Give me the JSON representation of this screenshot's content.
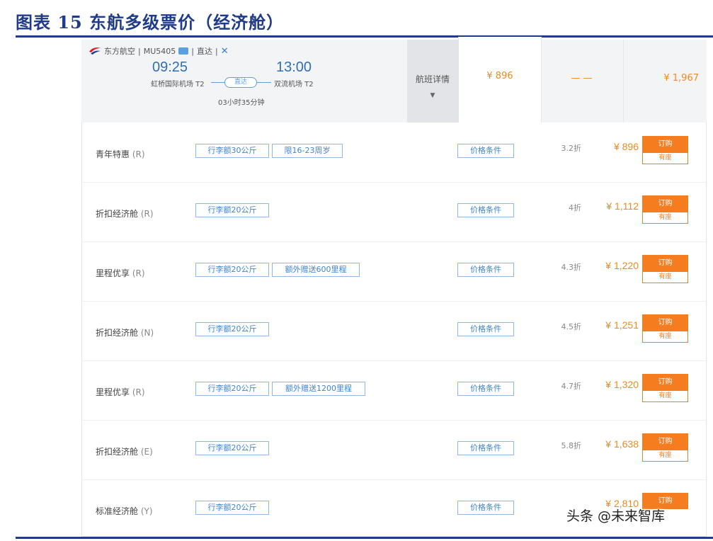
{
  "document": {
    "title": "图表 15    东航多级票价（经济舱）",
    "watermark": "头条 @未来智库"
  },
  "flight": {
    "airline": "东方航空",
    "flight_no": "MU5405",
    "direct_tag": "直达",
    "dep_time": "09:25",
    "arr_time": "13:00",
    "dep_airport": "虹桥国际机场 T2",
    "arr_airport": "双流机场 T2",
    "route_label": "直达",
    "duration": "03小时35分钟",
    "detail_label": "航班详情",
    "detail_caret": "▼"
  },
  "price_header": {
    "selected_price": "¥ 896",
    "empty_price": "— —",
    "other_price": "¥ 1,967"
  },
  "fares": [
    {
      "name": "青年特惠",
      "code": "(R)",
      "chips": [
        "行李额30公斤",
        "限16-23周岁"
      ],
      "condition": "价格条件",
      "discount": "3.2折",
      "price": "¥ 896",
      "book": "订购",
      "seat": "有座"
    },
    {
      "name": "折扣经济舱",
      "code": "(R)",
      "chips": [
        "行李额20公斤"
      ],
      "condition": "价格条件",
      "discount": "4折",
      "price": "¥ 1,112",
      "book": "订购",
      "seat": "有座"
    },
    {
      "name": "里程优享",
      "code": "(R)",
      "chips": [
        "行李额20公斤",
        "额外赠送600里程"
      ],
      "condition": "价格条件",
      "discount": "4.3折",
      "price": "¥ 1,220",
      "book": "订购",
      "seat": "有座"
    },
    {
      "name": "折扣经济舱",
      "code": "(N)",
      "chips": [
        "行李额20公斤"
      ],
      "condition": "价格条件",
      "discount": "4.5折",
      "price": "¥ 1,251",
      "book": "订购",
      "seat": "有座"
    },
    {
      "name": "里程优享",
      "code": "(R)",
      "chips": [
        "行李额20公斤",
        "额外赠送1200里程"
      ],
      "condition": "价格条件",
      "discount": "4.7折",
      "price": "¥ 1,320",
      "book": "订购",
      "seat": "有座"
    },
    {
      "name": "折扣经济舱",
      "code": "(E)",
      "chips": [
        "行李额20公斤"
      ],
      "condition": "价格条件",
      "discount": "5.8折",
      "price": "¥ 1,638",
      "book": "订购",
      "seat": "有座"
    },
    {
      "name": "标准经济舱",
      "code": "(Y)",
      "chips": [
        "行李额20公斤"
      ],
      "condition": "价格条件",
      "discount": "",
      "price": "¥ 2,810",
      "book": "订购",
      "seat": ""
    }
  ],
  "colors": {
    "title_blue": "#1f3b8a",
    "price_orange": "#f08a1c",
    "button_orange": "#f57c1f",
    "chip_blue": "#3f84d2"
  },
  "icons": {
    "airline_logo": "china-eastern-logo-icon",
    "info_tag": "info-tag-icon",
    "close": "x-icon"
  }
}
